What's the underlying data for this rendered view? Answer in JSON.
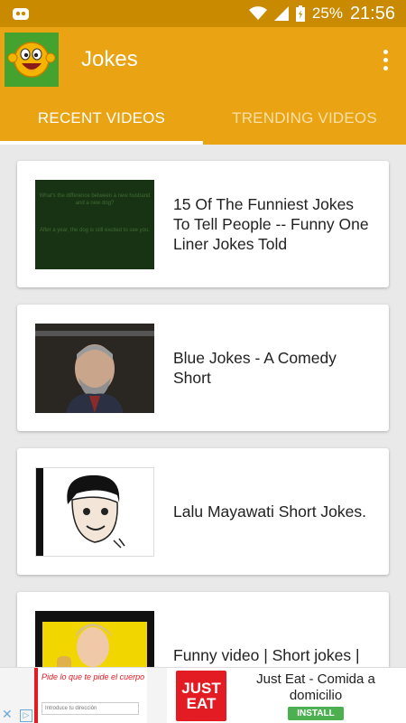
{
  "status_bar": {
    "battery": "25%",
    "time": "21:56",
    "icons": [
      "android-debug-icon",
      "wifi-icon",
      "signal-icon",
      "battery-charging-icon"
    ]
  },
  "app_bar": {
    "title": "Jokes",
    "logo_icon": "smiley-logo-icon",
    "menu_icon": "overflow-menu-icon",
    "color": "#eaa313"
  },
  "tabs": [
    {
      "label": "RECENT VIDEOS",
      "active": true
    },
    {
      "label": "TRENDING VIDEOS",
      "active": false
    }
  ],
  "videos": [
    {
      "title": "15 Of The Funniest Jokes To Tell People -- Funny One Liner Jokes Told",
      "thumb_text": [
        "What's the difference between a new husband and a new dog?",
        "After a year, the dog is still excited to see you."
      ]
    },
    {
      "title": "Blue Jokes - A Comedy Short"
    },
    {
      "title": "Lalu Mayawati Short Jokes."
    },
    {
      "title": "Funny video | Short jokes |"
    }
  ],
  "ad": {
    "tagline": "Pide lo que te pide el cuerpo",
    "input_placeholder": "Introduce tu dirección",
    "logo_line1": "JUST",
    "logo_line2": "EAT",
    "name": "Just Eat - Comida a domicilio",
    "install": "INSTALL",
    "brand_color": "#e31b23"
  }
}
